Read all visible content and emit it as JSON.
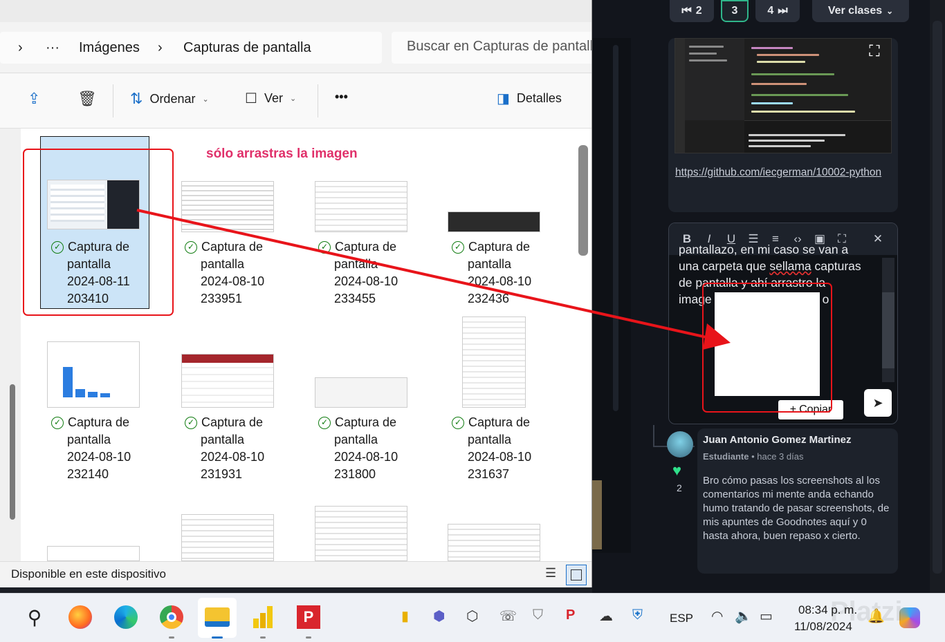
{
  "explorer": {
    "breadcrumb": {
      "chevron_start": "›",
      "more": "···",
      "folder1": "Imágenes",
      "sep": "›",
      "folder2": "Capturas de pantalla"
    },
    "search_placeholder": "Buscar en Capturas de pantalla",
    "toolbar": {
      "sort_label": "Ordenar",
      "view_label": "Ver",
      "more_label": "•••",
      "details_label": "Detalles"
    },
    "drag_note": "sólo arrastras la imagen",
    "status": "Disponible en este dispositivo",
    "files": [
      {
        "l1": "Captura de",
        "l2": "pantalla",
        "l3": "2024-08-11",
        "l4": "203410"
      },
      {
        "l1": "Captura de",
        "l2": "pantalla",
        "l3": "2024-08-10",
        "l4": "233951"
      },
      {
        "l1": "Captura de",
        "l2": "pantalla",
        "l3": "2024-08-10",
        "l4": "233455"
      },
      {
        "l1": "Captura de",
        "l2": "pantalla",
        "l3": "2024-08-10",
        "l4": "232436"
      },
      {
        "l1": "Captura de",
        "l2": "pantalla",
        "l3": "2024-08-10",
        "l4": "232140"
      },
      {
        "l1": "Captura de",
        "l2": "pantalla",
        "l3": "2024-08-10",
        "l4": "231931"
      },
      {
        "l1": "Captura de",
        "l2": "pantalla",
        "l3": "2024-08-10",
        "l4": "231800"
      },
      {
        "l1": "Captura de",
        "l2": "pantalla",
        "l3": "2024-08-10",
        "l4": "231637"
      }
    ]
  },
  "platzi": {
    "pagination": {
      "prev": "2",
      "current": "3",
      "next": "4",
      "classes": "Ver clases"
    },
    "link": "https://github.com/iecgerman/10002-python",
    "editor": {
      "text_line1": "pantallazo, en mi caso se van a",
      "text_line2a": "una carpeta que ",
      "text_line2b": "sellama",
      "text_line2c": " capturas",
      "text_line3": "de pantalla y ahí arrastro la",
      "text_line4a": "image",
      "text_line4b": "o",
      "copy_label": "Copiar"
    },
    "comment": {
      "author": "Juan Antonio Gomez Martinez",
      "role": "Estudiante",
      "time": "hace 3 días",
      "likes": "2",
      "body": "Bro cómo pasas los screenshots al los comentarios mi mente anda echando humo tratando de pasar screenshots, de mis apuntes de Goodnotes aquí y 0 hasta ahora, buen repaso x cierto."
    },
    "watermark": "Platzi"
  },
  "taskbar": {
    "lang": "ESP",
    "time": "08:34 p. m.",
    "date": "11/08/2024"
  },
  "colors": {
    "annotation_red": "#e8141a",
    "accent_green": "#2fb58a"
  }
}
